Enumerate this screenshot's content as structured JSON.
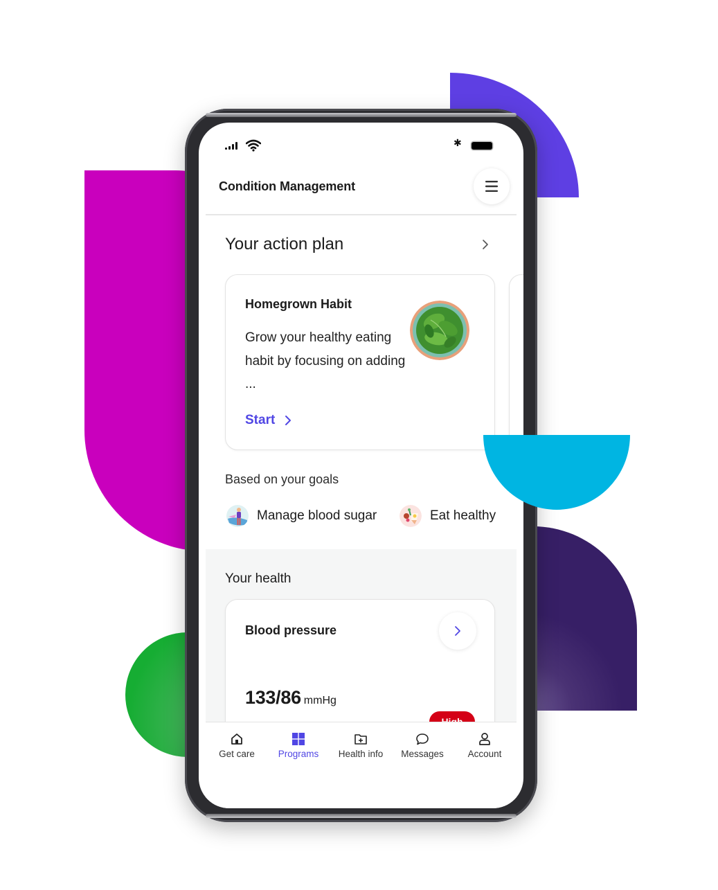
{
  "status_bar": {
    "signal_icon": "cellular-signal-icon",
    "wifi_icon": "wifi-icon",
    "bluetooth_icon": "bluetooth-icon",
    "bluetooth_glyph": "✱",
    "battery_icon": "battery-icon"
  },
  "header": {
    "title": "Condition Management",
    "menu_icon": "hamburger-menu-icon"
  },
  "action_plan": {
    "title": "Your action plan",
    "cards": [
      {
        "title": "Homegrown Habit",
        "description": "Grow your healthy eating habit by focusing on adding ...",
        "image": "spinach-bowl-image",
        "cta_label": "Start"
      }
    ]
  },
  "goals": {
    "title": "Based on your goals",
    "items": [
      {
        "label": "Manage blood sugar",
        "icon": "person-exercise-icon"
      },
      {
        "label": "Eat healthy",
        "icon": "healthy-food-icon"
      }
    ]
  },
  "health": {
    "title": "Your health",
    "cards": [
      {
        "title": "Blood pressure",
        "value": "133/86",
        "unit": "mmHg",
        "badge": "High"
      }
    ]
  },
  "tabbar": {
    "items": [
      {
        "label": "Get care",
        "icon": "home-icon",
        "active": false
      },
      {
        "label": "Programs",
        "icon": "grid-icon",
        "active": true
      },
      {
        "label": "Health info",
        "icon": "folder-plus-icon",
        "active": false
      },
      {
        "label": "Messages",
        "icon": "chat-bubble-icon",
        "active": false
      },
      {
        "label": "Account",
        "icon": "person-icon",
        "active": false
      }
    ]
  },
  "colors": {
    "accent": "#5046e4",
    "alert": "#d40016",
    "deco_magenta": "#c900bd",
    "deco_violet": "#5e3fe3",
    "deco_cyan": "#00b5e2",
    "deco_indigo": "#371f66",
    "deco_green": "#16ad33"
  }
}
